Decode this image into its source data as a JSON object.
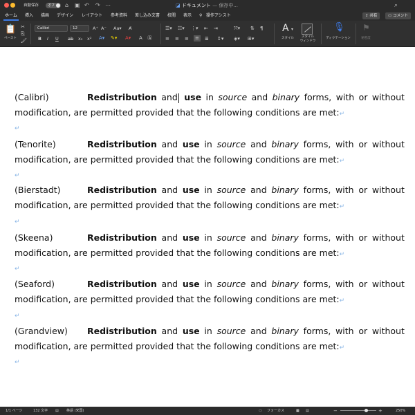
{
  "titlebar": {
    "traffic_colors": [
      "#ff5f57",
      "#febc2e",
      "#28c840"
    ],
    "autosave_label": "自動保存",
    "autosave_state": "オフ",
    "icons": [
      "home-icon",
      "save-icon",
      "undo-icon",
      "redo-icon",
      "more-icon"
    ],
    "doc_title": "ドキュメント",
    "doc_status": "— 保存中...",
    "search_icon": "search-icon"
  },
  "tabs": {
    "items": [
      "ホーム",
      "挿入",
      "描画",
      "デザイン",
      "レイアウト",
      "参考資料",
      "差し込み文書",
      "校閲",
      "表示"
    ],
    "active": "ホーム",
    "assist_label": "操作アシスト",
    "share_label": "共有",
    "comment_label": "コメント"
  },
  "ribbon": {
    "paste_label": "ペースト",
    "font_name": "Calibri",
    "font_size": "12",
    "styles_label": "スタイル",
    "styles_pane_label": "スタイル\nウィンドウ",
    "dictation_label": "ディクテーション",
    "sensitivity_label": "秘密度",
    "accent_color": "#3d7be8",
    "font_color_accent": "#e04040",
    "highlight_color": "#f2d700"
  },
  "document": {
    "sentence": {
      "w1": "Redistribution",
      "w2": "and",
      "w3": "use",
      "w4": "in",
      "w5": "source",
      "w6": "and",
      "w7": "binary",
      "w8": "forms,",
      "w9": "with",
      "w10": "or",
      "w11": "without",
      "line2": "modification, are permitted provided that the following conditions are met:"
    },
    "fonts": [
      "(Calibri)",
      "(Tenorite)",
      "(Bierstadt)",
      "(Skeena)",
      "(Seaford)",
      "(Grandview)"
    ],
    "paragraph_mark": "↵"
  },
  "statusbar": {
    "page": "1/1 ページ",
    "words": "132 文字",
    "language": "英語 (米国)",
    "focus_label": "フォーカス",
    "zoom": "250%",
    "zoom_fraction": 0.72
  }
}
